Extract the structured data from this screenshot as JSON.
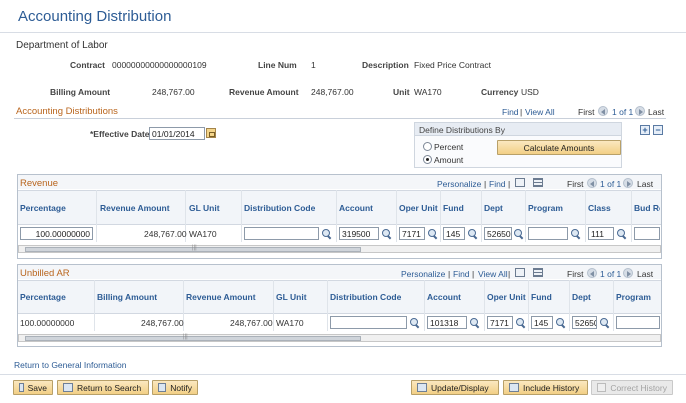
{
  "page": {
    "title": "Accounting Distribution",
    "department": "Department of Labor"
  },
  "header": {
    "contract_label": "Contract",
    "contract_value": "00000000000000000109",
    "line_num_label": "Line Num",
    "line_num_value": "1",
    "description_label": "Description",
    "description_value": "Fixed Price Contract",
    "billing_amount_label": "Billing Amount",
    "billing_amount_value": "248,767.00",
    "revenue_amount_label": "Revenue Amount",
    "revenue_amount_value": "248,767.00",
    "unit_label": "Unit",
    "unit_value": "WA170",
    "currency_label": "Currency",
    "currency_value": "USD"
  },
  "accounting_distributions": {
    "title": "Accounting Distributions",
    "find": "Find",
    "view_all": "View All",
    "first": "First",
    "counter": "1 of 1",
    "last": "Last",
    "effective_date_label": "*Effective Date",
    "effective_date_value": "01/01/2014",
    "define_by_title": "Define Distributions By",
    "percent_label": "Percent",
    "amount_label": "Amount",
    "calculate_button": "Calculate Amounts",
    "add": "+",
    "remove": "−"
  },
  "revenue": {
    "title": "Revenue",
    "personalize": "Personalize",
    "find": "Find",
    "first": "First",
    "counter": "1 of 1",
    "last": "Last",
    "columns": [
      "Percentage",
      "Revenue Amount",
      "GL Unit",
      "Distribution Code",
      "Account",
      "Oper Unit",
      "Fund",
      "Dept",
      "Program",
      "Class",
      "Bud Re"
    ],
    "row": {
      "percentage": "100.00000000",
      "revenue_amount": "248,767.00",
      "gl_unit": "WA170",
      "distribution_code": "",
      "account": "319500",
      "oper_unit": "7171",
      "fund": "145",
      "dept": "52650",
      "program": "",
      "class": "111",
      "bud_ref": ""
    }
  },
  "unbilled_ar": {
    "title": "Unbilled AR",
    "personalize": "Personalize",
    "find": "Find",
    "view_all": "View All",
    "first": "First",
    "counter": "1 of 1",
    "last": "Last",
    "columns": [
      "Percentage",
      "Billing Amount",
      "Revenue Amount",
      "GL Unit",
      "Distribution Code",
      "Account",
      "Oper Unit",
      "Fund",
      "Dept",
      "Program"
    ],
    "row": {
      "percentage": "100.00000000",
      "billing_amount": "248,767.00",
      "revenue_amount": "248,767.00",
      "gl_unit": "WA170",
      "distribution_code": "",
      "account": "101318",
      "oper_unit": "7171",
      "fund": "145",
      "dept": "52650",
      "program": ""
    }
  },
  "footer": {
    "return_link": "Return to General Information",
    "save": "Save",
    "return_to_search": "Return to Search",
    "notify": "Notify",
    "update_display": "Update/Display",
    "include_history": "Include History",
    "correct_history": "Correct History"
  },
  "scroll": {
    "divider_glyph": "|||"
  }
}
